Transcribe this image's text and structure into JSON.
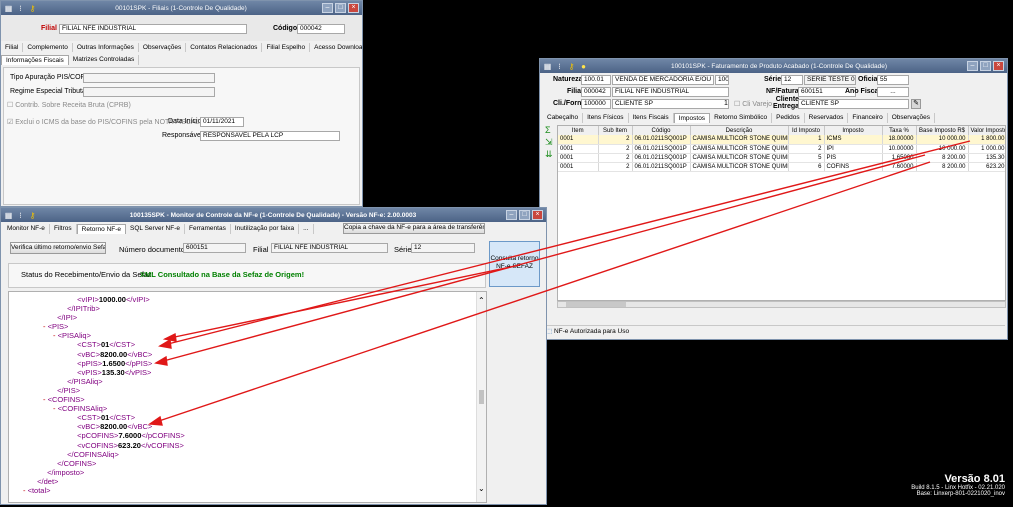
{
  "win1": {
    "title": "00101SPK - Filiais (1-Controle De Qualidade)",
    "filial_label": "Filial",
    "filial_value": "FILIAL NFE INDUSTRIAL",
    "codigo_label": "Código",
    "codigo_value": "000042",
    "tabs_row1": [
      "Filial",
      "Complemento",
      "Outras Informações",
      "Observações",
      "Contatos Relacionados",
      "Filial Espelho",
      "Acesso Download XML",
      "Log"
    ],
    "tabs_row2": [
      "Informações Fiscais",
      "Matrizes Controladas"
    ],
    "tipo_label": "Tipo Apuração PIS/COFINS:",
    "regime_label": "Regime Especial Tributação:",
    "contrib_label": "Contrib. Sobre Receita Bruta (CPRB)",
    "exclui_label": "Exclui o ICMS da base do PIS/COFINS pela NOTA FISCAL",
    "data_inicio_label": "Data Início:",
    "data_inicio_value": "01/11/2021",
    "responsavel_label": "Responsável:",
    "responsavel_value": "RESPONSAVEL PELA LCP"
  },
  "win2": {
    "title": "100101SPK - Faturamento de Produto Acabado (1-Controle De Qualidade)",
    "natureza_label": "Natureza",
    "natureza_code": "100.01",
    "natureza_desc": "VENDA DE MERCADORIA E/OU SERVI",
    "natureza_num": "100",
    "serie_label": "Série",
    "serie_value": "12",
    "serie_desc": "SERIE TESTE 01.1",
    "oficial_label": "Oficial",
    "oficial_value": "55",
    "filial_label": "Filial",
    "filial_code": "000042",
    "filial_desc": "FILIAL NFE INDUSTRIAL",
    "nf_label": "NF/Fatura",
    "nf_value": "600151",
    "ano_label": "Ano Fiscal",
    "ano_value": "...",
    "cli_label": "Cli./Forn.",
    "cli_code": "100000",
    "cli_desc": "CLIENTE SP",
    "cli_num": "1",
    "cli_varejo": "Cli Varejo",
    "cli_ent_label1": "Cliente",
    "cli_ent_label2": "Entrega",
    "cli_ent_value": "CLIENTE SP",
    "tabs": [
      "Cabeçalho",
      "Itens Físicos",
      "Itens Fiscais",
      "Impostos",
      "Retorno Simbólico",
      "Pedidos",
      "Reservados",
      "Financeiro",
      "Observações"
    ],
    "columns": [
      "Item",
      "Sub Item",
      "Código",
      "Descrição",
      "Id Imposto",
      "Imposto",
      "Taxa %",
      "Base Imposto R$",
      "Valor Imposto R"
    ],
    "rows": [
      [
        "0001",
        "2",
        "06.01.0211SQ001P",
        "CAMISA MULTICOR STONE QUIMICO P",
        "1",
        "ICMS",
        "18.00000",
        "10 000.00",
        "1 800.00"
      ],
      [
        "0001",
        "2",
        "06.01.0211SQ001P",
        "CAMISA MULTICOR STONE QUIMICO P",
        "2",
        "IPI",
        "10.00000",
        "10 000.00",
        "1 000.00"
      ],
      [
        "0001",
        "2",
        "06.01.0211SQ001P",
        "CAMISA MULTICOR STONE QUIMICO P",
        "5",
        "PIS",
        "1.65000",
        "8 200.00",
        "135.30"
      ],
      [
        "0001",
        "2",
        "06.01.0211SQ001P",
        "CAMISA MULTICOR STONE QUIMICO P",
        "6",
        "COFINS",
        "7.60000",
        "8 200.00",
        "623.20"
      ]
    ],
    "status": "NF-e Autorizada para Uso"
  },
  "win3": {
    "title": "100135SPK - Monitor de Controle da NF-e (1-Controle De Qualidade) - Versão NF-e: 2.00.0003",
    "tabs": [
      "Monitor NF-e",
      "Filtros",
      "Retorno NF-e",
      "SQL Server NF-e",
      "Ferramentas",
      "Inutilização por faixa",
      "..."
    ],
    "copy_btn": "Copia a chave da NF-e para a área de transferência",
    "verify_btn": "Verifica último retorno/envio Sefaz",
    "doc_label": "Número documento",
    "doc_value": "600151",
    "filial_label": "Filial",
    "filial_value": "FILIAL NFE INDUSTRIAL",
    "serie_label": "Série",
    "serie_value": "12",
    "consulta_btn": "Consulta retorno NF-e SEFAZ",
    "status_label": "Status do Recebimento/Envio da Sefaz:",
    "status_value": "XML Consultado na Base da Sefaz de Origem!",
    "xml_lines": [
      {
        "i": 6,
        "m": "",
        "o": "<vIPI>",
        "v": "1000.00",
        "c": "</vIPI>"
      },
      {
        "i": 5,
        "m": "",
        "o": "</IPITrib>",
        "v": "",
        "c": ""
      },
      {
        "i": 4,
        "m": "",
        "o": "</IPI>",
        "v": "",
        "c": ""
      },
      {
        "i": 3,
        "m": "-",
        "o": "<PIS>",
        "v": "",
        "c": ""
      },
      {
        "i": 4,
        "m": "-",
        "o": "<PISAliq>",
        "v": "",
        "c": ""
      },
      {
        "i": 6,
        "m": "",
        "o": "<CST>",
        "v": "01",
        "c": "</CST>"
      },
      {
        "i": 6,
        "m": "",
        "o": "<vBC>",
        "v": "8200.00",
        "c": "</vBC>"
      },
      {
        "i": 6,
        "m": "",
        "o": "<pPIS>",
        "v": "1.6500",
        "c": "</pPIS>"
      },
      {
        "i": 6,
        "m": "",
        "o": "<vPIS>",
        "v": "135.30",
        "c": "</vPIS>"
      },
      {
        "i": 5,
        "m": "",
        "o": "</PISAliq>",
        "v": "",
        "c": ""
      },
      {
        "i": 4,
        "m": "",
        "o": "</PIS>",
        "v": "",
        "c": ""
      },
      {
        "i": 3,
        "m": "-",
        "o": "<COFINS>",
        "v": "",
        "c": ""
      },
      {
        "i": 4,
        "m": "-",
        "o": "<COFINSAliq>",
        "v": "",
        "c": ""
      },
      {
        "i": 6,
        "m": "",
        "o": "<CST>",
        "v": "01",
        "c": "</CST>"
      },
      {
        "i": 6,
        "m": "",
        "o": "<vBC>",
        "v": "8200.00",
        "c": "</vBC>"
      },
      {
        "i": 6,
        "m": "",
        "o": "<pCOFINS>",
        "v": "7.6000",
        "c": "</pCOFINS>"
      },
      {
        "i": 6,
        "m": "",
        "o": "<vCOFINS>",
        "v": "623.20",
        "c": "</vCOFINS>"
      },
      {
        "i": 5,
        "m": "",
        "o": "</COFINSAliq>",
        "v": "",
        "c": ""
      },
      {
        "i": 4,
        "m": "",
        "o": "</COFINS>",
        "v": "",
        "c": ""
      },
      {
        "i": 3,
        "m": "",
        "o": "</imposto>",
        "v": "",
        "c": ""
      },
      {
        "i": 2,
        "m": "",
        "o": "</det>",
        "v": "",
        "c": ""
      },
      {
        "i": 1,
        "m": "-",
        "o": "<total>",
        "v": "",
        "c": ""
      }
    ]
  },
  "footer": {
    "version": "Versão 8.01",
    "build": "Build 8.1.5 - Linx Hotfix - 02.21.020",
    "base": "Base: Linxerp-801-0221020_inov"
  },
  "colors": {
    "arrow": "#e01818",
    "titlebar": "#5a7194",
    "accent_red": "#c00000",
    "status_green": "#008000"
  }
}
